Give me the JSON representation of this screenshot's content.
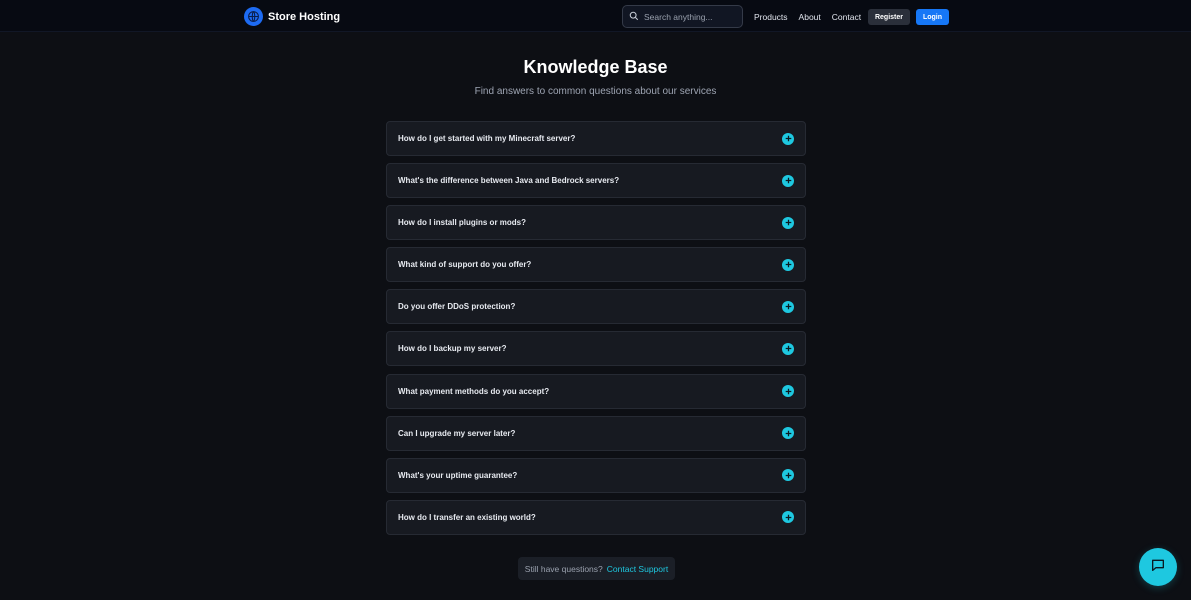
{
  "brand": {
    "name": "Store Hosting",
    "accent": "#1d6bf3",
    "icon": "globe-icon"
  },
  "search": {
    "placeholder": "Search anything...",
    "value": "",
    "icon": "search-icon"
  },
  "nav": {
    "products": "Products",
    "about": "About",
    "contact": "Contact"
  },
  "auth": {
    "register": "Register",
    "login": "Login"
  },
  "header": {
    "title": "Knowledge Base",
    "subtitle": "Find answers to common questions about our services"
  },
  "faq": [
    {
      "question": "How do I get started with my Minecraft server?"
    },
    {
      "question": "What's the difference between Java and Bedrock servers?"
    },
    {
      "question": "How do I install plugins or mods?"
    },
    {
      "question": "What kind of support do you offer?"
    },
    {
      "question": "Do you offer DDoS protection?"
    },
    {
      "question": "How do I backup my server?"
    },
    {
      "question": "What payment methods do you accept?"
    },
    {
      "question": "Can I upgrade my server later?"
    },
    {
      "question": "What's your uptime guarantee?"
    },
    {
      "question": "How do I transfer an existing world?"
    }
  ],
  "footer": {
    "text": "Still have questions?",
    "link": "Contact Support"
  },
  "chat": {
    "icon": "chat-icon",
    "color": "#1ec8e0"
  },
  "colors": {
    "background": "#0d0f14",
    "card": "#171a21",
    "accent": "#1ec8e0",
    "primary": "#1677f6"
  }
}
